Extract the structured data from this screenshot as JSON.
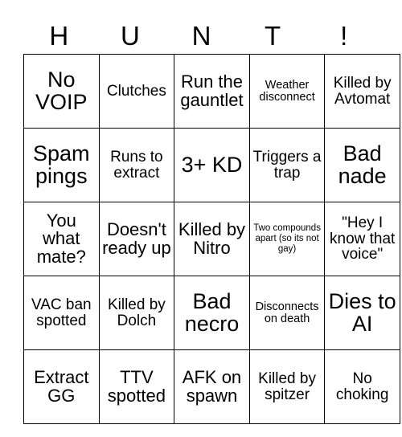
{
  "card": {
    "header_letters": [
      "H",
      "U",
      "N",
      "T",
      "!"
    ],
    "rows": [
      [
        {
          "text": "No VOIP",
          "size": "fs-xl"
        },
        {
          "text": "Clutches",
          "size": "fs-md"
        },
        {
          "text": "Run the gauntlet",
          "size": "fs-lg"
        },
        {
          "text": "Weather disconnect",
          "size": "fs-sm"
        },
        {
          "text": "Killed by Avtomat",
          "size": "fs-md"
        }
      ],
      [
        {
          "text": "Spam pings",
          "size": "fs-xl"
        },
        {
          "text": "Runs to extract",
          "size": "fs-md"
        },
        {
          "text": "3+ KD",
          "size": "fs-xl"
        },
        {
          "text": "Triggers a trap",
          "size": "fs-md"
        },
        {
          "text": "Bad nade",
          "size": "fs-xl"
        }
      ],
      [
        {
          "text": "You what mate?",
          "size": "fs-lg"
        },
        {
          "text": "Doesn't ready up",
          "size": "fs-lg"
        },
        {
          "text": "Killed by Nitro",
          "size": "fs-lg"
        },
        {
          "text": "Two compounds apart (so its not gay)",
          "size": "fs-xs"
        },
        {
          "text": "\"Hey I know that voice\"",
          "size": "fs-md"
        }
      ],
      [
        {
          "text": "VAC ban spotted",
          "size": "fs-md"
        },
        {
          "text": "Killed by Dolch",
          "size": "fs-md"
        },
        {
          "text": "Bad necro",
          "size": "fs-xl"
        },
        {
          "text": "Disconnects on death",
          "size": "fs-sm"
        },
        {
          "text": "Dies to AI",
          "size": "fs-xl"
        }
      ],
      [
        {
          "text": "Extract GG",
          "size": "fs-lg"
        },
        {
          "text": "TTV spotted",
          "size": "fs-lg"
        },
        {
          "text": "AFK on spawn",
          "size": "fs-lg"
        },
        {
          "text": "Killed by spitzer",
          "size": "fs-md"
        },
        {
          "text": "No choking",
          "size": "fs-md"
        }
      ]
    ]
  }
}
